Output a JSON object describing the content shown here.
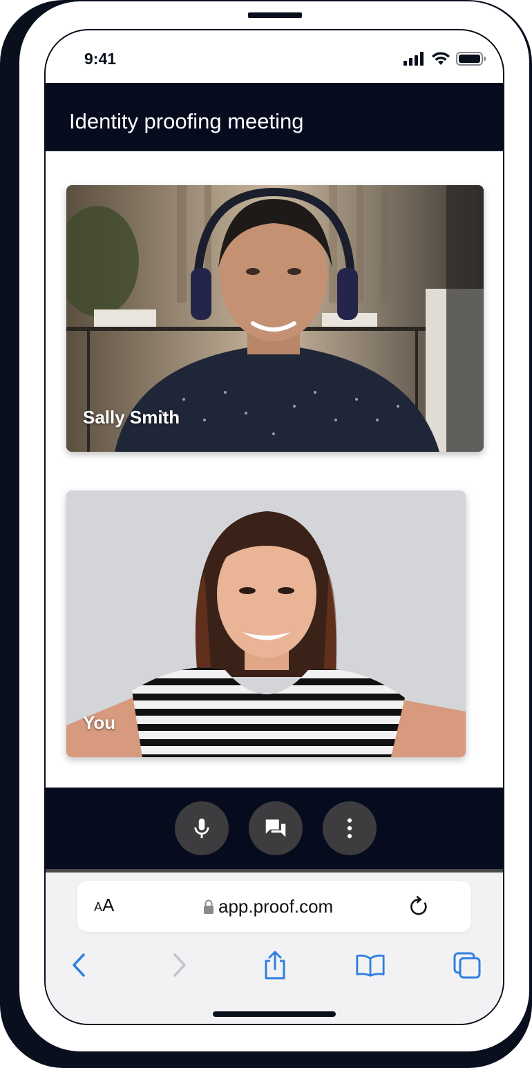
{
  "status_bar": {
    "time": "9:41"
  },
  "header": {
    "title": "Identity proofing meeting"
  },
  "participants": [
    {
      "name": "Sally Smith"
    },
    {
      "name": "You"
    }
  ],
  "controls": [
    "mic-icon",
    "chat-icon",
    "more-icon"
  ],
  "browser": {
    "text_size_label_big": "A",
    "text_size_label_small": "A",
    "url": "app.proof.com"
  },
  "colors": {
    "header_bg": "#070b1e",
    "control_btn": "#3d3d3f",
    "safari_blue": "#2f7fe0"
  }
}
